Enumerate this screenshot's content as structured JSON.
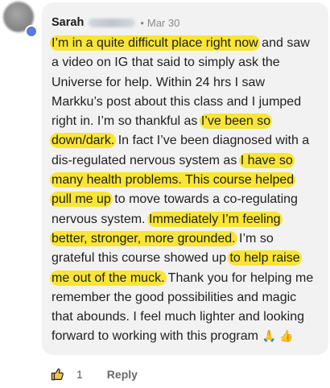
{
  "comment": {
    "author": "Sarah",
    "separator": "•",
    "timestamp": "Mar 30",
    "lines": [
      [
        {
          "t": "I’m in a quite difficult place right now",
          "hl": true
        },
        {
          "t": " and saw",
          "hl": false
        }
      ],
      [
        {
          "t": "a video on IG that said to simply ask the",
          "hl": false
        }
      ],
      [
        {
          "t": "Universe for help. Within 24 hrs I saw",
          "hl": false
        }
      ],
      [
        {
          "t": "Markku’s post about this class and I jumped",
          "hl": false
        }
      ],
      [
        {
          "t": "right in. I’m so thankful as ",
          "hl": false
        },
        {
          "t": "I’ve been so",
          "hl": true
        }
      ],
      [
        {
          "t": "down/dark.",
          "hl": true
        },
        {
          "t": " In fact I’ve been diagnosed with a",
          "hl": false
        }
      ],
      [
        {
          "t": "dis-regulated nervous system as ",
          "hl": false
        },
        {
          "t": "I have so",
          "hl": true
        }
      ],
      [
        {
          "t": "many health problems. This course helped",
          "hl": true
        }
      ],
      [
        {
          "t": "pull me up",
          "hl": true
        },
        {
          "t": " to move towards a co-regulating",
          "hl": false
        }
      ],
      [
        {
          "t": "nervous system. ",
          "hl": false
        },
        {
          "t": "Immediately I’m feeling",
          "hl": true
        }
      ],
      [
        {
          "t": "better, stronger, more grounded.",
          "hl": true
        },
        {
          "t": " I’m so",
          "hl": false
        }
      ],
      [
        {
          "t": "grateful this course showed up ",
          "hl": false
        },
        {
          "t": "to help raise",
          "hl": true
        }
      ],
      [
        {
          "t": "me out of the muck.",
          "hl": true
        },
        {
          "t": " Thank you for helping me",
          "hl": false
        }
      ],
      [
        {
          "t": "remember the good possibilities and magic",
          "hl": false
        }
      ],
      [
        {
          "t": "that abounds. I feel much lighter and looking",
          "hl": false
        }
      ],
      [
        {
          "t": "forward to working with this program ",
          "hl": false
        },
        {
          "t": "🙏 👍",
          "hl": false,
          "emoji": true
        }
      ]
    ]
  },
  "footer": {
    "like_icon": "thumbs-up-icon",
    "like_count": "1",
    "reply_label": "Reply"
  },
  "colors": {
    "highlight": "#f8e537",
    "bubble": "#f2f2f2",
    "online_dot": "#5b7bd6"
  }
}
